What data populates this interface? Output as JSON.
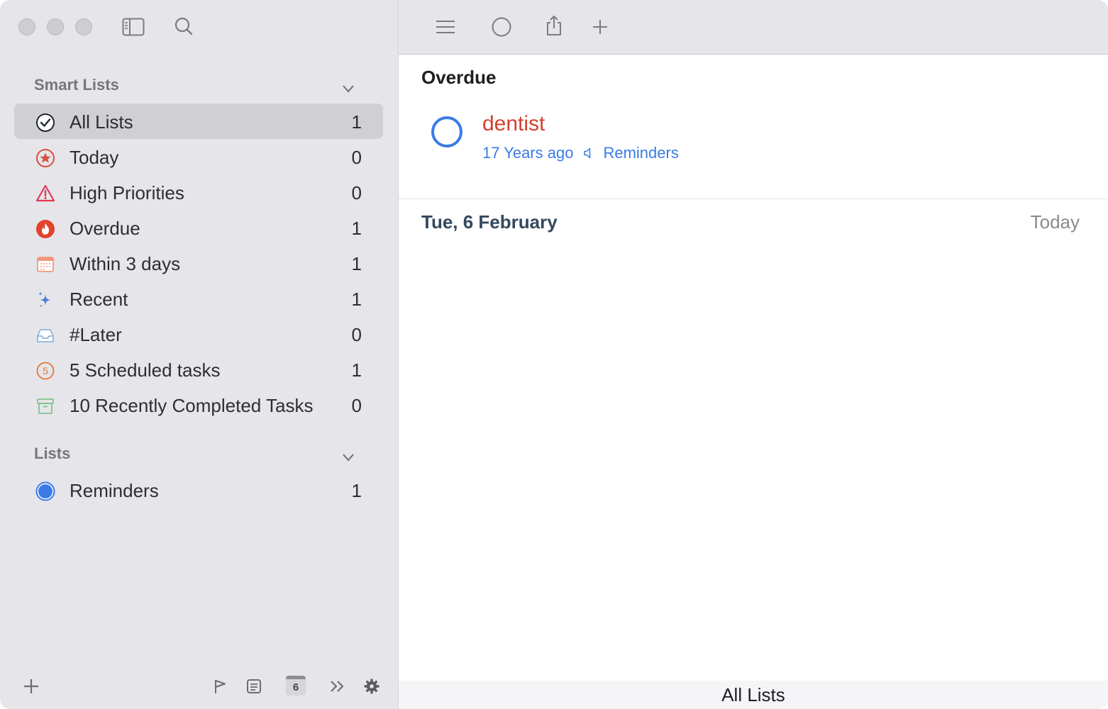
{
  "sidebar": {
    "smart_lists_header": "Smart Lists",
    "lists_header": "Lists",
    "smart_lists": [
      {
        "label": "All Lists",
        "count": "1",
        "icon": "checkmark-circle-icon",
        "selected": true
      },
      {
        "label": "Today",
        "count": "0",
        "icon": "star-circle-icon"
      },
      {
        "label": "High Priorities",
        "count": "0",
        "icon": "warning-triangle-icon"
      },
      {
        "label": "Overdue",
        "count": "1",
        "icon": "flame-icon"
      },
      {
        "label": "Within 3 days",
        "count": "1",
        "icon": "calendar-icon"
      },
      {
        "label": "Recent",
        "count": "1",
        "icon": "sparkles-icon"
      },
      {
        "label": "#Later",
        "count": "0",
        "icon": "tray-icon"
      },
      {
        "label": "5 Scheduled tasks",
        "count": "1",
        "icon": "number-five-circle-icon"
      },
      {
        "label": "10 Recently Completed Tasks",
        "count": "0",
        "icon": "archive-box-icon"
      }
    ],
    "lists": [
      {
        "label": "Reminders",
        "count": "1",
        "icon": "blue-dot-icon"
      }
    ],
    "bottom_bar": {
      "calendar_day": "6"
    }
  },
  "main": {
    "overdue_header": "Overdue",
    "task": {
      "title": "dentist",
      "due": "17 Years ago",
      "list": "Reminders"
    },
    "date_header": "Tue, 6 February",
    "date_relative": "Today",
    "status_title": "All Lists"
  },
  "colors": {
    "accent": "#3a7be8",
    "overdue_red": "#d4402f",
    "sidebar_bg": "#e6e5ea",
    "selection_bg": "#d0cfd4"
  }
}
